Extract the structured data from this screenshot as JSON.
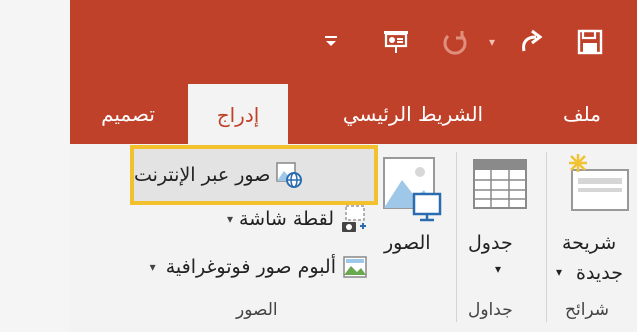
{
  "window": {
    "accent_color": "#c0412a",
    "qat_icons": [
      "save-icon",
      "redo-icon",
      "undo-icon",
      "presentation-icon",
      "customize-qat-icon"
    ]
  },
  "tabs": [
    {
      "label": "ملف",
      "active": false
    },
    {
      "label": "الشريط الرئيسي",
      "active": false
    },
    {
      "label": "إدراج",
      "active": true
    },
    {
      "label": "تصميم",
      "active": false
    }
  ],
  "ribbon": {
    "slides": {
      "label_line1": "شريحة",
      "label_line2": "جديدة",
      "group": "شرائح"
    },
    "tables": {
      "label": "جدول",
      "group": "جداول"
    },
    "images": {
      "pictures_label": "الصور",
      "online_pictures": "صور عبر الإنترنت",
      "screenshot": "لقطة شاشة",
      "photo_album": "ألبوم صور فوتوغرافية",
      "group": "الصور"
    }
  }
}
